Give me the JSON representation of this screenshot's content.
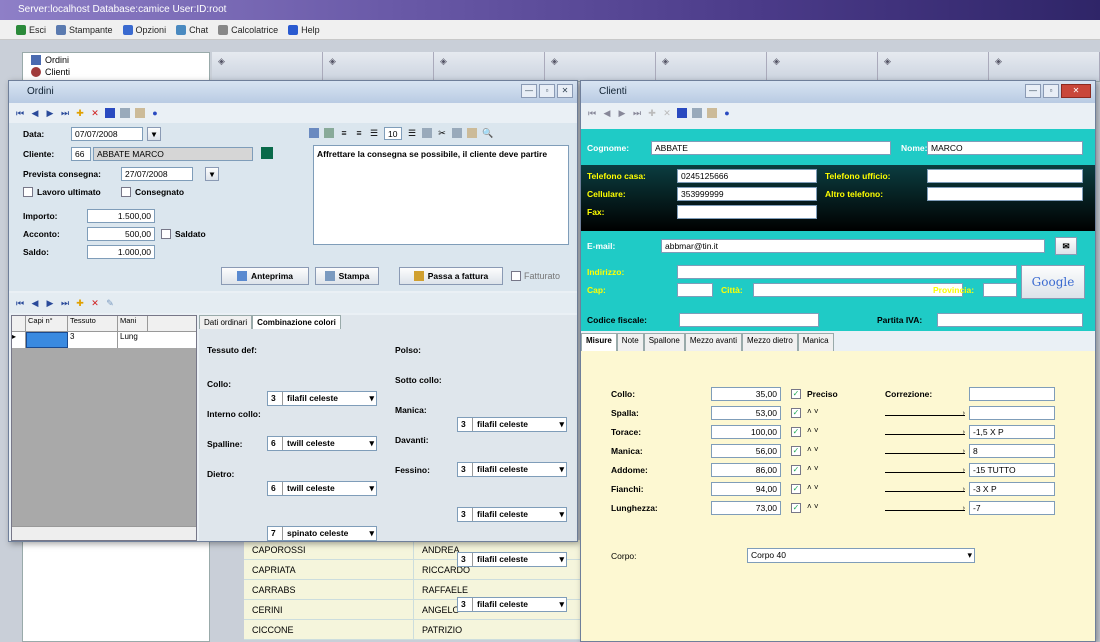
{
  "app": {
    "title": "Server:localhost Database:camice User:ID:root"
  },
  "menu": [
    {
      "label": "Esci",
      "icon": "exit-icon",
      "color": "#2a8a3a"
    },
    {
      "label": "Stampante",
      "icon": "printer-icon",
      "color": "#5a7ab0"
    },
    {
      "label": "Opzioni",
      "icon": "gear-icon",
      "color": "#3a6ad0"
    },
    {
      "label": "Chat",
      "icon": "chat-icon",
      "color": "#4a8ac0"
    },
    {
      "label": "Calcolatrice",
      "icon": "calculator-icon",
      "color": "#888"
    },
    {
      "label": "Help",
      "icon": "help-icon",
      "color": "#2a5ad0"
    }
  ],
  "nav": {
    "ordini": "Ordini",
    "clienti": "Clienti"
  },
  "list_rows": [
    {
      "cognome": "CAPOROSSI",
      "nome": "ANDREA"
    },
    {
      "cognome": "CAPRIATA",
      "nome": "RICCARDO"
    },
    {
      "cognome": "CARRABS",
      "nome": "RAFFAELE"
    },
    {
      "cognome": "CERINI",
      "nome": "ANGELO"
    },
    {
      "cognome": "CICCONE",
      "nome": "PATRIZIO"
    }
  ],
  "ordini": {
    "title": "Ordini",
    "data_label": "Data:",
    "data_value": "07/07/2008",
    "cliente_label": "Cliente:",
    "cliente_code": "66",
    "cliente_name": "ABBATE MARCO",
    "consegna_label": "Prevista consegna:",
    "consegna_value": "27/07/2008",
    "lavoro_label": "Lavoro ultimato",
    "consegnato_label": "Consegnato",
    "importo_label": "Importo:",
    "importo_value": "1.500,00",
    "acconto_label": "Acconto:",
    "acconto_value": "500,00",
    "saldato_label": "Saldato",
    "saldo_label": "Saldo:",
    "saldo_value": "1.000,00",
    "note_text": "Affrettare la consegna se possibile, il cliente deve partire",
    "zoom_value": "10",
    "btn_anteprima": "Anteprima",
    "btn_stampa": "Stampa",
    "btn_fattura": "Passa a fattura",
    "fatturato": "Fatturato",
    "grid_headers": [
      "Capi n°",
      "Tessuto",
      "Mani"
    ],
    "grid_row": [
      "",
      "3",
      "Lung"
    ],
    "tabs": [
      "Dati ordinari",
      "Combinazione colori"
    ],
    "tessuto_label": "Tessuto def:",
    "left_fields": [
      {
        "label": "Collo:",
        "num": "3",
        "value": "filafil celeste"
      },
      {
        "label": "Interno collo:",
        "num": "6",
        "value": "twill celeste"
      },
      {
        "label": "Spalline:",
        "num": "6",
        "value": "twill celeste"
      },
      {
        "label": "Dietro:",
        "num": "7",
        "value": "spinato celeste"
      }
    ],
    "right_fields": [
      {
        "label": "Polso:",
        "num": "3",
        "value": "filafil celeste"
      },
      {
        "label": "Sotto collo:",
        "num": "3",
        "value": "filafil celeste"
      },
      {
        "label": "Manica:",
        "num": "3",
        "value": "filafil celeste"
      },
      {
        "label": "Davanti:",
        "num": "3",
        "value": "filafil celeste"
      },
      {
        "label": "Fessino:",
        "num": "3",
        "value": "filafil celeste"
      }
    ]
  },
  "clienti": {
    "title": "Clienti",
    "cognome_label": "Cognome:",
    "cognome_value": "ABBATE",
    "nome_label": "Nome:",
    "nome_value": "MARCO",
    "tel_casa_label": "Telefono casa:",
    "tel_casa_value": "0245125666",
    "tel_uff_label": "Telefono ufficio:",
    "cell_label": "Cellulare:",
    "cell_value": "353999999",
    "altro_label": "Altro telefono:",
    "fax_label": "Fax:",
    "email_label": "E-mail:",
    "email_value": "abbmar@tin.it",
    "indirizzo_label": "Indirizzo:",
    "cap_label": "Cap:",
    "citta_label": "Città:",
    "provincia_label": "Provincia:",
    "google_label": "Google",
    "cf_label": "Codice fiscale:",
    "piva_label": "Partita IVA:",
    "tabs": [
      "Misure",
      "Note",
      "Spallone",
      "Mezzo avanti",
      "Mezzo dietro",
      "Manica"
    ],
    "correzione_label": "Correzione:",
    "preciso_label": "Preciso",
    "misure": [
      {
        "label": "Collo:",
        "value": "35,00",
        "corr": ""
      },
      {
        "label": "Spalla:",
        "value": "53,00",
        "corr": ""
      },
      {
        "label": "Torace:",
        "value": "100,00",
        "corr": "-1,5 X P"
      },
      {
        "label": "Manica:",
        "value": "56,00",
        "corr": "8"
      },
      {
        "label": "Addome:",
        "value": "86,00",
        "corr": "-15 TUTTO"
      },
      {
        "label": "Fianchi:",
        "value": "94,00",
        "corr": "-3 X P"
      },
      {
        "label": "Lunghezza:",
        "value": "73,00",
        "corr": "-7"
      }
    ],
    "corpo_label": "Corpo:",
    "corpo_value": "Corpo 40"
  }
}
